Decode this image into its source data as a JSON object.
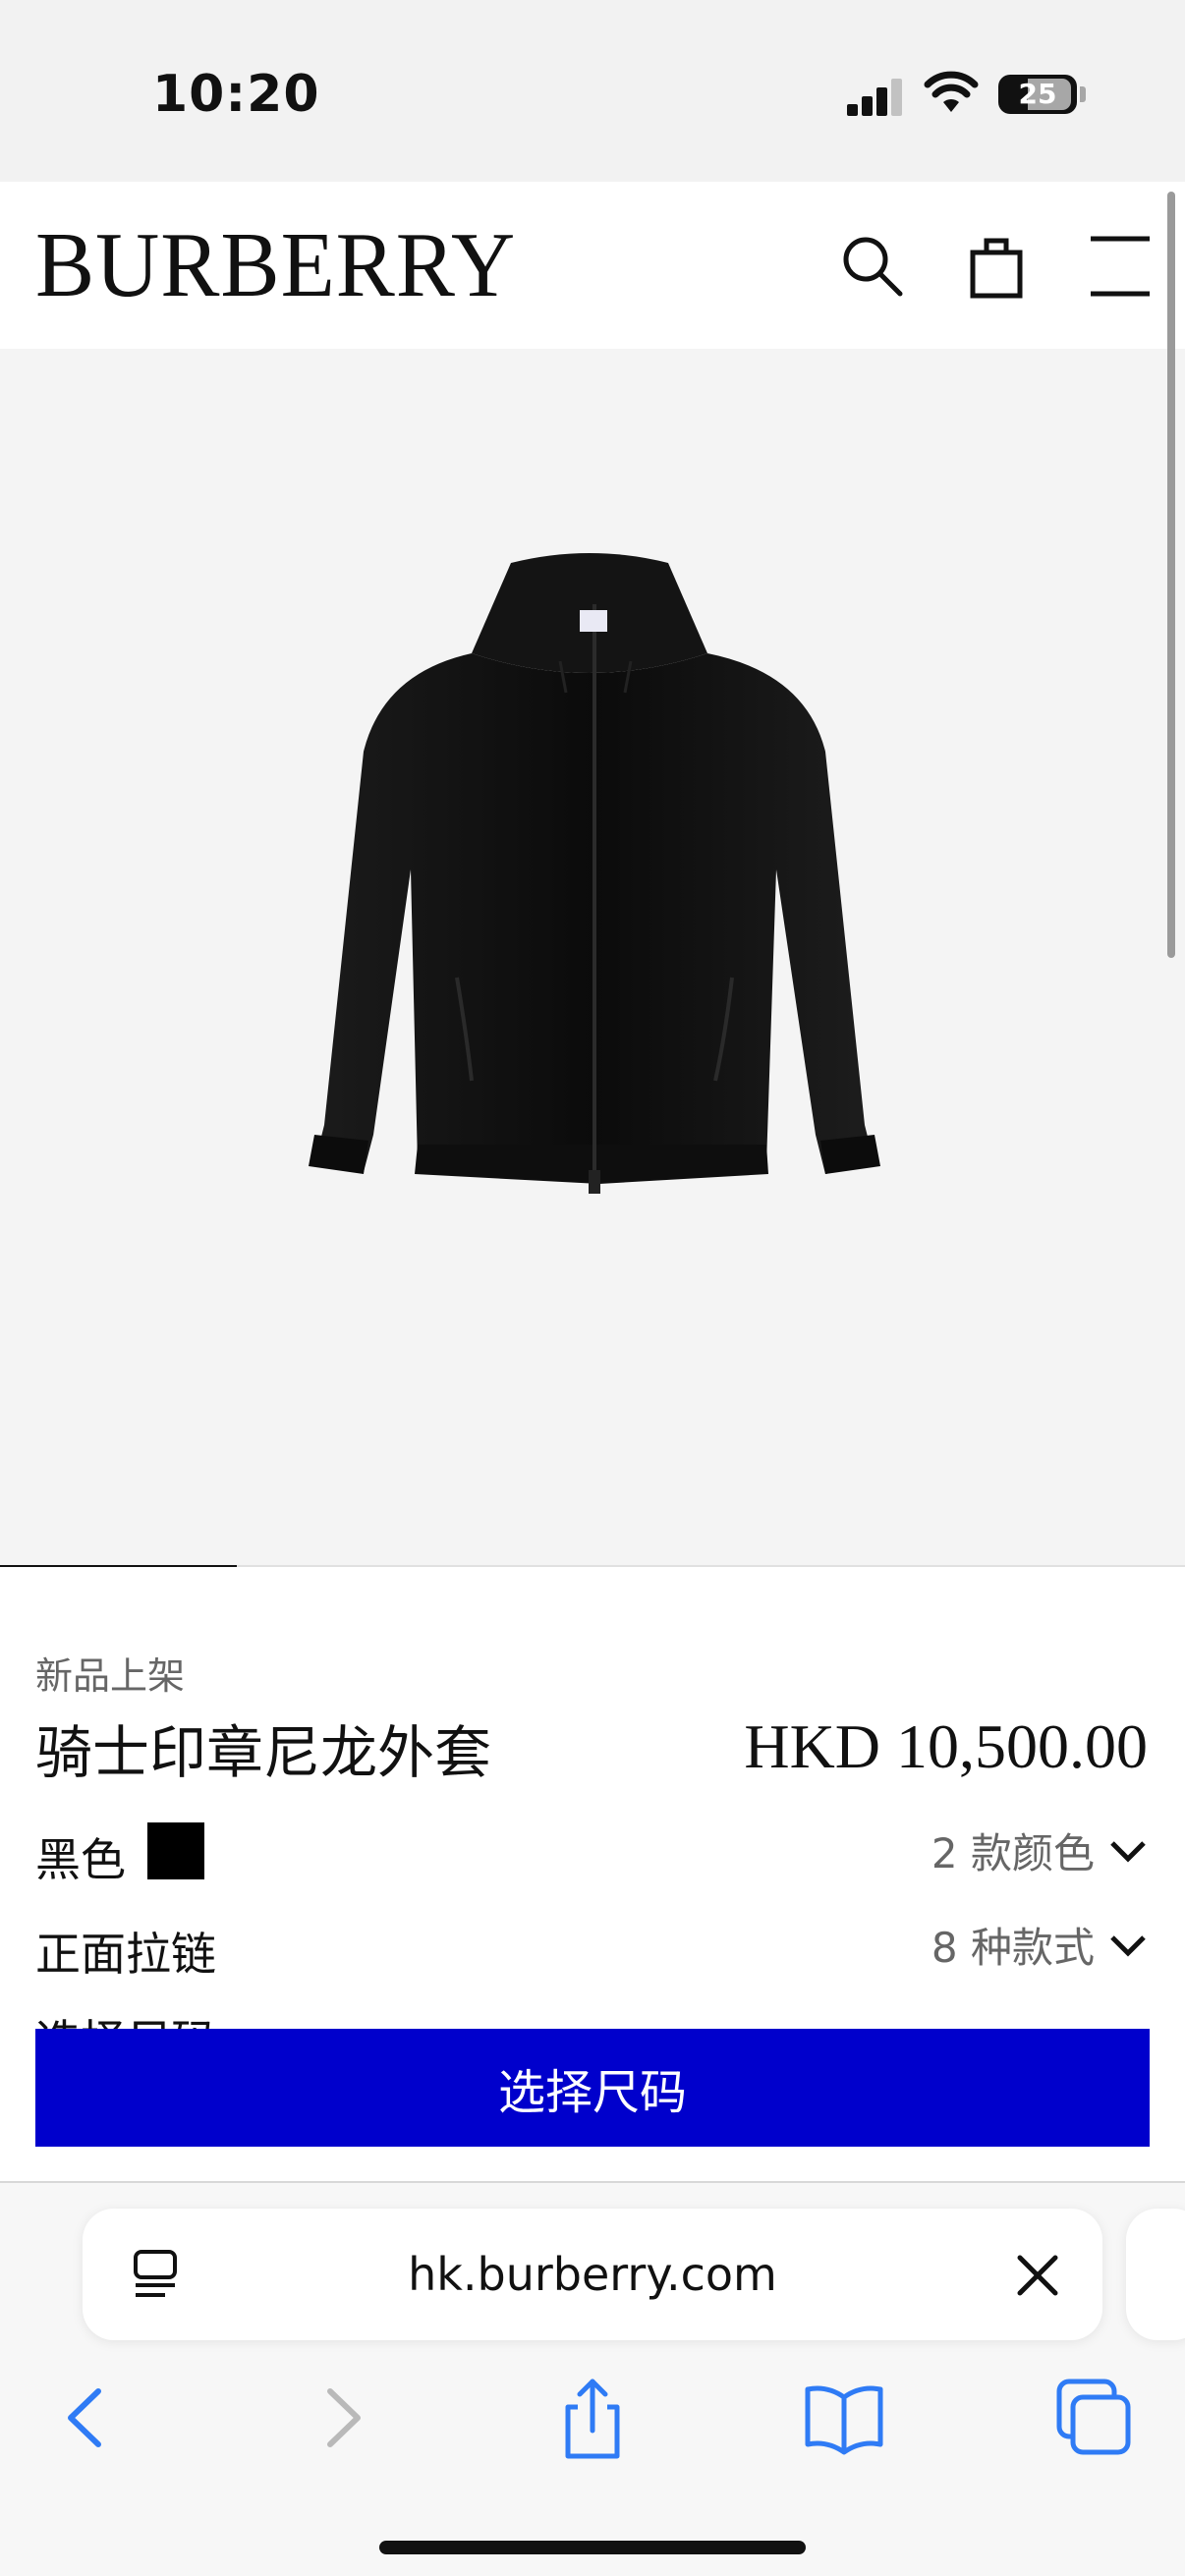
{
  "status_bar": {
    "time": "10:20",
    "battery_level": "25"
  },
  "header": {
    "brand": "BURBERRY",
    "icons": [
      "search-icon",
      "bag-icon",
      "menu-icon"
    ]
  },
  "gallery": {
    "image_subject": "black-hooded-nylon-jacket",
    "progress": 0.2
  },
  "product": {
    "tag": "新品上架",
    "name": "骑士印章尼龙外套",
    "price": "HKD 10,500.00",
    "color_label": "黑色",
    "swatch_color": "#000000",
    "colors_link": "2 款颜色",
    "style_label": "正面拉链",
    "styles_link": "8 种款式",
    "size_label": "选择尺码",
    "select_size_button": "选择尺码",
    "accent_color": "#0000cc"
  },
  "browser": {
    "url": "hk.burberry.com",
    "toolbar_icons": [
      "back-icon",
      "forward-icon",
      "share-icon",
      "bookmarks-icon",
      "tabs-icon"
    ]
  }
}
